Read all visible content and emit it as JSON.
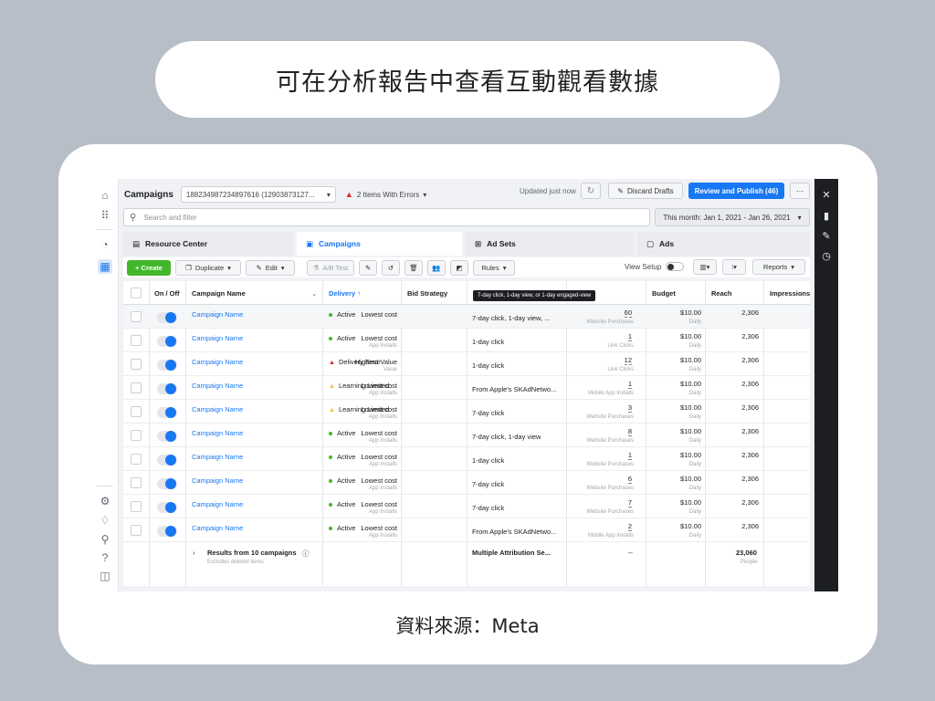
{
  "slide": {
    "title": "可在分析報告中查看互動觀看數據",
    "source": "資料來源：Meta"
  },
  "app": {
    "page_title": "Campaigns",
    "account_id": "188234987234897616 (12903873127...",
    "errors": "2 Items With Errors",
    "updated": "Updated just now",
    "discard": "Discard Drafts",
    "review": "Review and Publish (46)",
    "more": "···",
    "search_placeholder": "Search and filter",
    "date_range": "This month: Jan 1, 2021 - Jan 26, 2021",
    "tabs": {
      "resource": "Resource Center",
      "campaigns": "Campaigns",
      "adsets": "Ad Sets",
      "ads": "Ads"
    },
    "toolbar": {
      "create": "+ Create",
      "duplicate": "Duplicate",
      "edit": "Edit",
      "abtest": "A/B Test",
      "rules": "Rules",
      "view_setup": "View Setup",
      "reports": "Reports"
    },
    "tooltip": "7-day click, 1-day view, or 1-day engaged-view",
    "columns": {
      "onoff": "On / Off",
      "name": "Campaign Name",
      "delivery": "Delivery ↑",
      "bid": "Bid Strategy",
      "budget": "Budget",
      "reach": "Reach",
      "impressions": "Impressions"
    },
    "rows": [
      {
        "name": "Campaign Name",
        "delivery": "Active",
        "dcolor": "#42b72a",
        "dsym": "dot",
        "bid": "Lowest cost",
        "bidsub": "",
        "attr": "7-day click, 1-day view, ...",
        "result": "60",
        "resultsub": "Website Purchases",
        "budget": "$10.00",
        "budgetsub": "Daily",
        "reach": "2,306"
      },
      {
        "name": "Campaign Name",
        "delivery": "Active",
        "dcolor": "#42b72a",
        "dsym": "dot",
        "bid": "Lowest cost",
        "bidsub": "App Installs",
        "attr": "1-day click",
        "result": "1",
        "resultsub": "Link Clicks",
        "budget": "$10.00",
        "budgetsub": "Daily",
        "reach": "2,306"
      },
      {
        "name": "Campaign Name",
        "delivery": "Delivery Error",
        "dcolor": "#e02424",
        "dsym": "tri",
        "bid": "Highest Value",
        "bidsub": "Value",
        "attr": "1-day click",
        "result": "12",
        "resultsub": "Link Clicks",
        "budget": "$10.00",
        "budgetsub": "Daily",
        "reach": "2,306"
      },
      {
        "name": "Campaign Name",
        "delivery": "Learning Limited",
        "dcolor": "#f7b928",
        "dsym": "tri",
        "bid": "Lowest cost",
        "bidsub": "App Installs",
        "attr": "From Apple's SKAdNetwo...",
        "result": "1",
        "resultsub": "Mobile App Installs",
        "budget": "$10.00",
        "budgetsub": "Daily",
        "reach": "2,306"
      },
      {
        "name": "Campaign Name",
        "delivery": "Learning Limited",
        "dcolor": "#f7b928",
        "dsym": "tri",
        "bid": "Lowest cost",
        "bidsub": "App Installs",
        "attr": "7-day click",
        "result": "3",
        "resultsub": "Website Purchases",
        "budget": "$10.00",
        "budgetsub": "Daily",
        "reach": "2,306"
      },
      {
        "name": "Campaign Name",
        "delivery": "Active",
        "dcolor": "#42b72a",
        "dsym": "dot",
        "bid": "Lowest cost",
        "bidsub": "App Installs",
        "attr": "7-day click, 1-day view",
        "result": "8",
        "resultsub": "Website Purchases",
        "budget": "$10.00",
        "budgetsub": "Daily",
        "reach": "2,306"
      },
      {
        "name": "Campaign Name",
        "delivery": "Active",
        "dcolor": "#42b72a",
        "dsym": "dot",
        "bid": "Lowest cost",
        "bidsub": "App Installs",
        "attr": "1-day click",
        "result": "1",
        "resultsub": "Website Purchases",
        "budget": "$10.00",
        "budgetsub": "Daily",
        "reach": "2,306"
      },
      {
        "name": "Campaign Name",
        "delivery": "Active",
        "dcolor": "#42b72a",
        "dsym": "dot",
        "bid": "Lowest cost",
        "bidsub": "App Installs",
        "attr": "7-day click",
        "result": "6",
        "resultsub": "Website Purchases",
        "budget": "$10.00",
        "budgetsub": "Daily",
        "reach": "2,306"
      },
      {
        "name": "Campaign Name",
        "delivery": "Active",
        "dcolor": "#42b72a",
        "dsym": "dot",
        "bid": "Lowest cost",
        "bidsub": "App Installs",
        "attr": "7-day click",
        "result": "7",
        "resultsub": "Website Purchases",
        "budget": "$10.00",
        "budgetsub": "Daily",
        "reach": "2,306"
      },
      {
        "name": "Campaign Name",
        "delivery": "Active",
        "dcolor": "#42b72a",
        "dsym": "dot",
        "bid": "Lowest cost",
        "bidsub": "App Installs",
        "attr": "From Apple's SKAdNetwo...",
        "result": "2",
        "resultsub": "Mobile App Installs",
        "budget": "$10.00",
        "budgetsub": "Daily",
        "reach": "2,306"
      }
    ],
    "summary": {
      "label": "Results from 10 campaigns",
      "sub": "Excludes deleted items",
      "attr": "Multiple Attribution Se...",
      "result": "--",
      "reach": "23,060",
      "reachsub": "People"
    }
  }
}
